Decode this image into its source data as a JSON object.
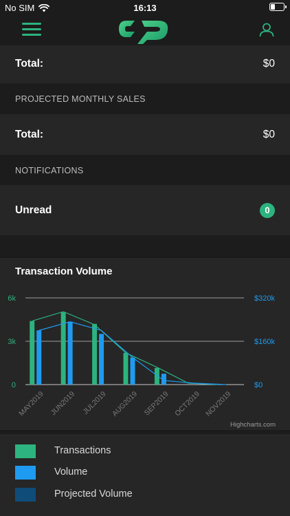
{
  "status_bar": {
    "carrier": "No SIM",
    "time": "16:13"
  },
  "summary": {
    "total_label": "Total:",
    "total_value": "$0"
  },
  "projected": {
    "header": "PROJECTED MONTHLY SALES",
    "total_label": "Total:",
    "total_value": "$0"
  },
  "notifications": {
    "header": "NOTIFICATIONS",
    "unread_label": "Unread",
    "unread_count": "0"
  },
  "chart_title": "Transaction Volume",
  "chart_data": {
    "type": "bar",
    "title": "Transaction Volume",
    "categories": [
      "MAY2019",
      "JUN2019",
      "JUL2019",
      "AUG2019",
      "SEP2019",
      "OCT2019",
      "NOV2019"
    ],
    "y_left": {
      "ticks": [
        "0",
        "3k",
        "6k"
      ],
      "range": [
        0,
        6000
      ]
    },
    "y_right": {
      "ticks": [
        "$0",
        "$160k",
        "$320k"
      ],
      "range": [
        0,
        320000
      ]
    },
    "series": [
      {
        "name": "Transactions",
        "color": "#2db37f",
        "axis": "left",
        "values": [
          4400,
          5000,
          4200,
          2200,
          1150,
          0,
          0
        ],
        "line": [
          4400,
          5050,
          4150,
          2200,
          1200,
          100,
          0
        ]
      },
      {
        "name": "Volume",
        "color": "#1e9bf0",
        "axis": "right",
        "values": [
          200000,
          232000,
          187000,
          100000,
          40000,
          0,
          0
        ],
        "line": [
          200000,
          232000,
          200000,
          100000,
          15000,
          5000,
          0
        ]
      },
      {
        "name": "Projected Volume",
        "color": "#0f4c78",
        "axis": "right",
        "values": [
          0,
          0,
          0,
          0,
          0,
          0,
          0
        ]
      }
    ],
    "grid": true,
    "legend": "bottom",
    "credits": "Highcharts.com"
  },
  "legend": [
    {
      "label": "Transactions",
      "color": "#2db37f"
    },
    {
      "label": "Volume",
      "color": "#1e9bf0"
    },
    {
      "label": "Projected Volume",
      "color": "#0f4c78"
    }
  ],
  "icons": {
    "menu": "menu-icon",
    "logo": "logo",
    "user": "user-icon",
    "wifi": "wifi-icon",
    "battery": "battery-icon"
  }
}
